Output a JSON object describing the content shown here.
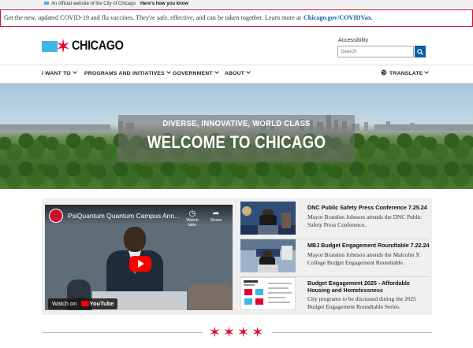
{
  "official_banner": {
    "text": "An official website of the City of Chicago",
    "link": "Here's how you know"
  },
  "alert": {
    "text": "Get the new, updated COVID-19 and flu vaccines. They're safe, effective, and can be taken together. Learn more at",
    "link": "Chicago.gov/COVIDVax."
  },
  "header": {
    "logo_text": "CHICAGO",
    "accessibility_label": "Accessibility",
    "search_placeholder": "Search"
  },
  "nav": {
    "items": [
      {
        "label": "I WANT TO"
      },
      {
        "label": "PROGRAMS AND INITIATIVES"
      },
      {
        "label": "GOVERNMENT"
      },
      {
        "label": "ABOUT"
      }
    ],
    "translate_label": "TRANSLATE"
  },
  "hero": {
    "tagline": "DIVERSE, INNOVATIVE, WORLD CLASS",
    "headline": "WELCOME TO CHICAGO"
  },
  "video": {
    "title": "PsiQuantum Quantum Campus Ann...",
    "watch_later": "Watch later",
    "share": "Share",
    "watch_on": "Watch on",
    "youtube": "YouTube"
  },
  "news": [
    {
      "title": "DNC Public Safety Press Conference 7.25.24",
      "description": "Mayor Brandon Johnson attends the DNC Public Safety Press Conference."
    },
    {
      "title": "MBJ Budget Engagement Roundtable 7.22.24",
      "description": "Mayor Brandon Johnson attends the Malcolm X College Budget Engagement Roundtable."
    },
    {
      "title": "Budget Engagement 2025 - Affordable Housing and Homelessness",
      "description": "City programs to be discussed during the 2025 Budget Engagement Roundtable Series."
    }
  ],
  "colors": {
    "brand_red": "#e4002b",
    "brand_blue": "#41b6e6",
    "link_blue": "#1a5ea8",
    "button_blue": "#0d5ca8"
  }
}
